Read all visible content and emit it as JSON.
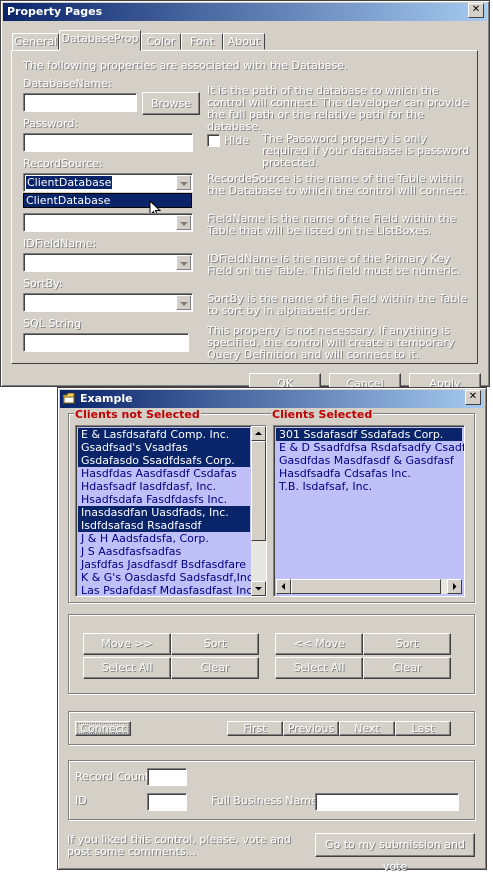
{
  "property_pages": {
    "title": "Property Pages",
    "tabs": [
      "General",
      "DatabaseProp",
      "Color",
      "Font",
      "About"
    ],
    "intro": "The following properties are associated with the Database.",
    "database_name_label": "DatabaseName:",
    "browse_label": "Browse",
    "database_name_desc": "It is the path of the database to which the control will connect. The developer can provide the full path or the relative path for the database.",
    "password_label": "Password:",
    "hide_label": "Hide",
    "password_desc": "The Password property is only required if your database is password protected.",
    "record_source_label": "RecordSource:",
    "record_source_value": "ClientDatabase",
    "record_source_option": "ClientDatabase",
    "record_source_desc": "RecordeSource is the name of the Table within the Database to which the control will connect.",
    "field_name_desc": "FieldName is the name of the Field within the Table that will be listed on the ListBoxes.",
    "id_field_label": "IDFieldName:",
    "id_field_desc": "IDFieldName is the name of the Primary Key Field on the Table. This field must be numeric.",
    "sort_by_label": "SortBy:",
    "sort_by_desc": "SortBy is the name of the Field within the Table to sort by in alphabetic order.",
    "sql_label": "SQL String",
    "sql_desc": "This property is not necessary. If anything is specified, the control will create a temporary Query Definition and will connect to it.",
    "ok_label": "OK",
    "cancel_label": "Cancel",
    "apply_label": "Apply"
  },
  "example": {
    "title": "Example",
    "not_selected_label": "Clients not Selected",
    "selected_label": "Clients Selected",
    "not_selected_items": [
      {
        "text": "E & Lasfdsafafd Comp. Inc.",
        "selected": true
      },
      {
        "text": "Gsadfsad's Vsadfas",
        "selected": true
      },
      {
        "text": "Gsdafasdo Ssadfdsafs Corp.",
        "selected": true
      },
      {
        "text": "Hasdfdas Aasdfasdf Csdafas",
        "selected": false
      },
      {
        "text": "Hdasfsadf Iasdfdasf, Inc.",
        "selected": false
      },
      {
        "text": "Hsadfsdafa Fasdfdasfs Inc.",
        "selected": false
      },
      {
        "text": "Inasdasdfan Uasdfads, Inc.",
        "selected": true
      },
      {
        "text": "Isdfdsafasd Rsadfasdf",
        "selected": true
      },
      {
        "text": "J & H Aadsfadsfa, Corp.",
        "selected": false
      },
      {
        "text": "J S Aasdfasfsadfas",
        "selected": false
      },
      {
        "text": "Jasfdfas Jasdfasdf Bsdfasdfare",
        "selected": false
      },
      {
        "text": "K & G's Oasdasfd Sadsfasdf,Inc.",
        "selected": false
      },
      {
        "text": "Las Psdafdasf Mdasfasdfast Inc.",
        "selected": false
      }
    ],
    "selected_items": [
      {
        "text": "301 Ssdafasdf Ssdafads Corp.",
        "selected": true
      },
      {
        "text": "E & D Ssadfdfsa Rsdafsadfy Csadfdsa S",
        "selected": false
      },
      {
        "text": "Gasdfdas Masdfasdf & Gasdfasf",
        "selected": false
      },
      {
        "text": "Hasdfsadfa Cdsafas Inc.",
        "selected": false
      },
      {
        "text": "T.B. Isdafsaf, Inc.",
        "selected": false
      }
    ],
    "move_right": "Move >>",
    "sort": "Sort",
    "select_all": "Select All",
    "clear": "Clear",
    "move_left": "<< Move",
    "connect": "Connect",
    "first": "First",
    "previous": "Previous",
    "next": "Next",
    "last": "Last",
    "record_count_label": "Record Count",
    "id_label": "ID",
    "full_business_name_label": "Full Business Name",
    "footer_text": "If you liked this control, please, vote and post some comments...",
    "vote_button": "Go to my submission and vote"
  }
}
